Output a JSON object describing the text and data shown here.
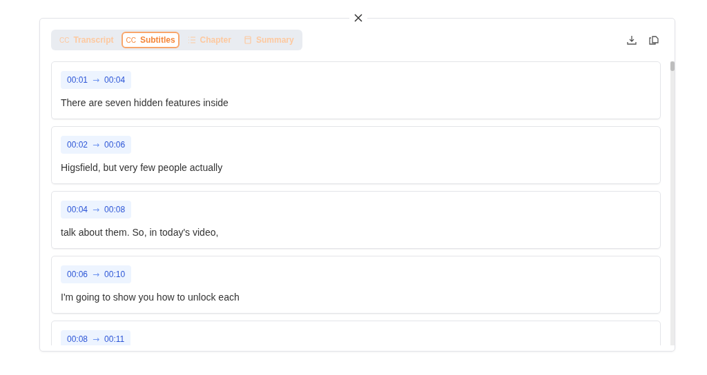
{
  "tabs": [
    {
      "label": "Transcript",
      "kind": "cc",
      "icon_text": "CC",
      "selected": false
    },
    {
      "label": "Subtitles",
      "kind": "cc",
      "icon_text": "CC",
      "selected": true
    },
    {
      "label": "Chapter",
      "kind": "list",
      "selected": false
    },
    {
      "label": "Summary",
      "kind": "note",
      "selected": false
    }
  ],
  "subtitles": [
    {
      "start": "00:01",
      "arrow": "→",
      "end": "00:04",
      "text": "There are seven hidden features inside"
    },
    {
      "start": "00:02",
      "arrow": "→",
      "end": "00:06",
      "text": "Higsfield, but very few people actually"
    },
    {
      "start": "00:04",
      "arrow": "→",
      "end": "00:08",
      "text": "talk about them. So, in today's video,"
    },
    {
      "start": "00:06",
      "arrow": "→",
      "end": "00:10",
      "text": "I'm going to show you how to unlock each"
    },
    {
      "start": "00:08",
      "arrow": "→",
      "end": "00:11"
    }
  ]
}
